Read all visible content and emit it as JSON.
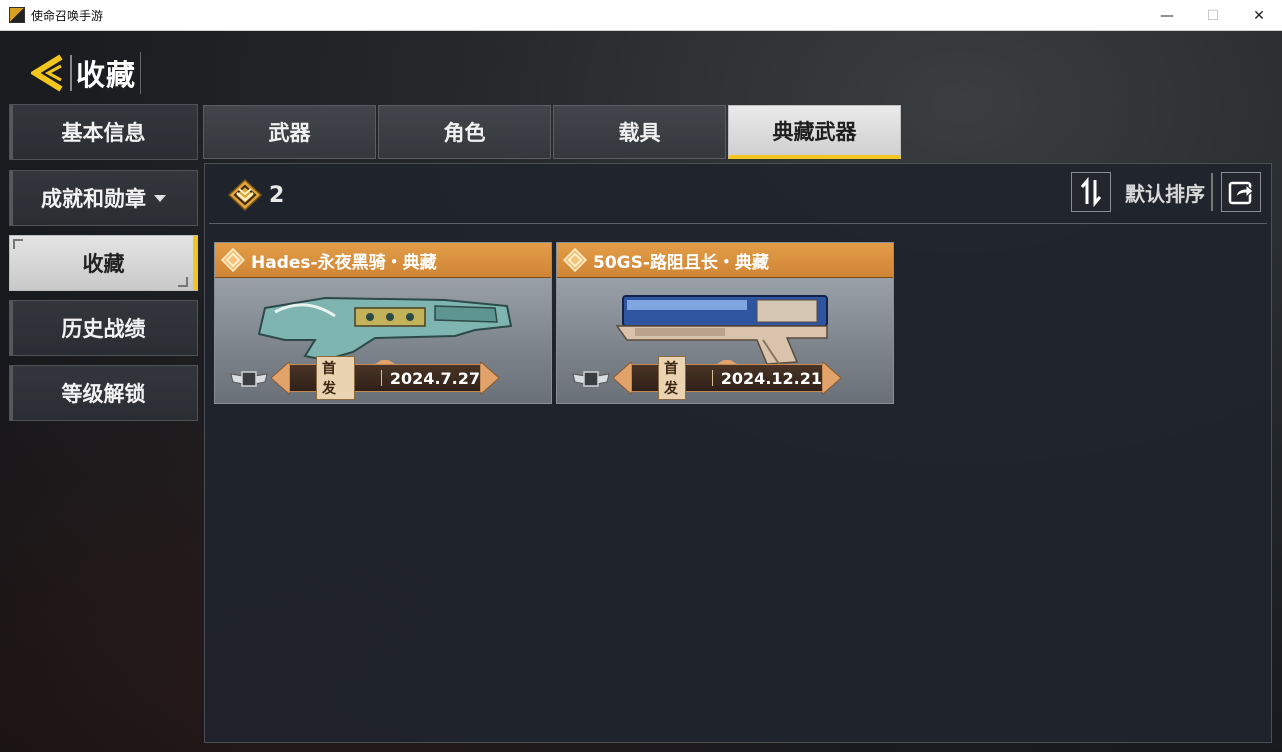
{
  "window": {
    "title": "使命召唤手游",
    "controls": {
      "minimize": "—",
      "maximize": "☐",
      "close": "✕"
    }
  },
  "header": {
    "title": "收藏"
  },
  "sidebar": {
    "items": [
      {
        "label": "基本信息",
        "active": false
      },
      {
        "label": "成就和勋章",
        "active": false,
        "has_dropdown": true
      },
      {
        "label": "收藏",
        "active": true
      },
      {
        "label": "历史战绩",
        "active": false
      },
      {
        "label": "等级解锁",
        "active": false
      }
    ]
  },
  "tabs": [
    {
      "label": "武器",
      "active": false
    },
    {
      "label": "角色",
      "active": false
    },
    {
      "label": "载具",
      "active": false
    },
    {
      "label": "典藏武器",
      "active": true
    }
  ],
  "panel": {
    "count": "2",
    "sort_label": "默认排序",
    "icons": {
      "count": "diamond-rank-icon",
      "sort": "sort-arrows-icon",
      "share": "share-icon"
    }
  },
  "cards": [
    {
      "name": "Hades-永夜黑骑・典藏",
      "tag": "首发",
      "date": "2024.7.27"
    },
    {
      "name": "50GS-路阻且长・典藏",
      "tag": "首发",
      "date": "2024.12.21"
    }
  ],
  "colors": {
    "accent": "#f2c61c",
    "card_header": "#e39d48"
  }
}
